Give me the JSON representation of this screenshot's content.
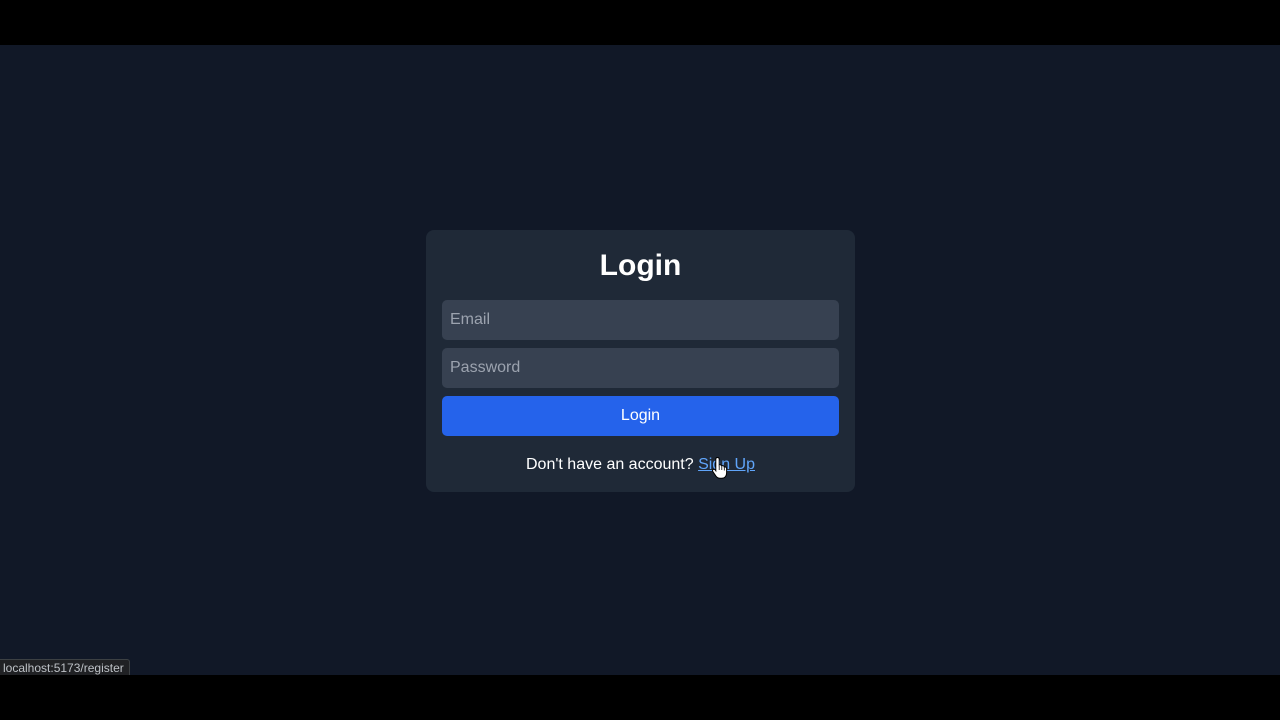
{
  "login_card": {
    "title": "Login",
    "email_placeholder": "Email",
    "password_placeholder": "Password",
    "submit_label": "Login",
    "signup_prompt": "Don't have an account?",
    "signup_link": "Sign Up"
  },
  "status_bar": {
    "url": "localhost:5173/register"
  },
  "colors": {
    "page_background": "#111827",
    "card_background": "#1f2937",
    "input_background": "#374151",
    "button": "#2563eb",
    "link": "#60a5fa"
  },
  "icons": {
    "cursor": "hand-pointer-icon"
  }
}
